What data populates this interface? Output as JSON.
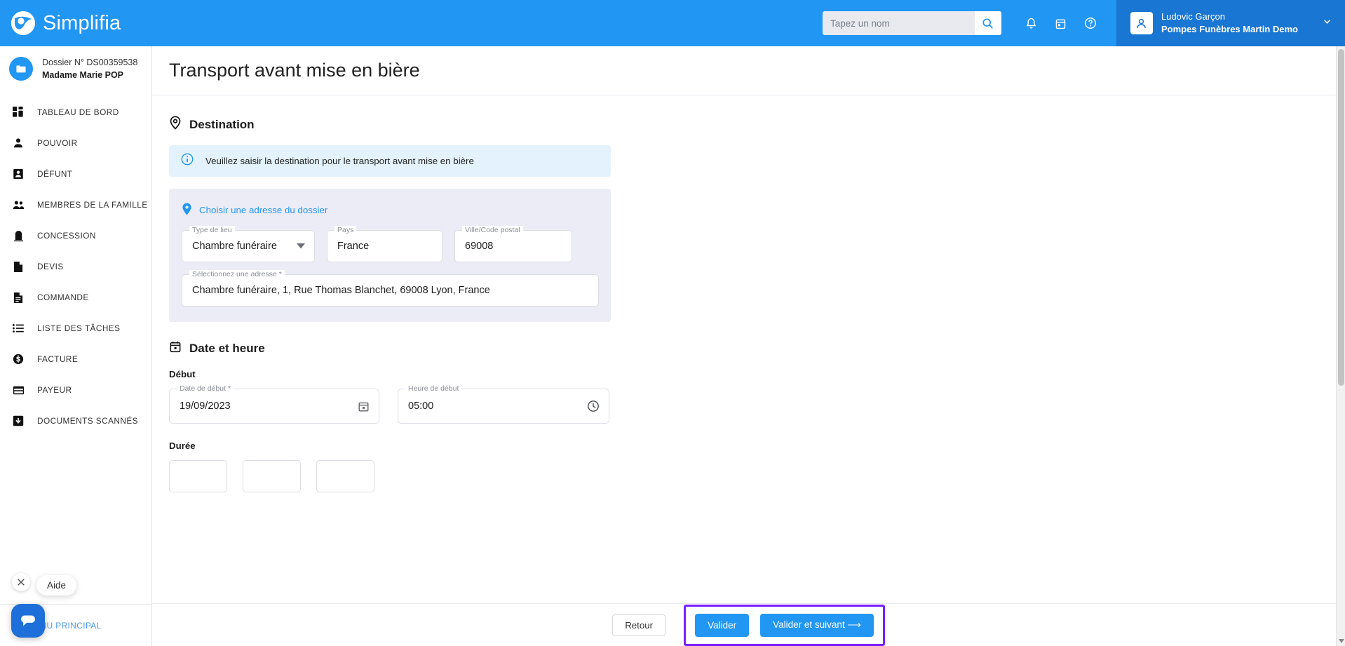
{
  "header": {
    "brand": "Simplifia",
    "search": {
      "placeholder": "Tapez un nom",
      "value": ""
    },
    "icons": {
      "search": "search-icon",
      "bell": "bell-icon",
      "calendar": "calendar-icon",
      "help": "help-circle-icon",
      "chevron": "chevron-down-icon"
    },
    "user": {
      "name": "Ludovic Garçon",
      "org": "Pompes Funèbres Martin Demo"
    },
    "brand_color": "#2196f3",
    "user_chip_color": "#1976d2"
  },
  "sidebar": {
    "dossier": {
      "number": "Dossier N° DS00359538",
      "person": "Madame Marie POP",
      "icon": "folder-icon"
    },
    "items": [
      {
        "label": "Tableau de bord",
        "icon": "dashboard-icon"
      },
      {
        "label": "Pouvoir",
        "icon": "person-icon"
      },
      {
        "label": "Défunt",
        "icon": "person-badge-icon"
      },
      {
        "label": "Membres de la famille",
        "icon": "people-icon"
      },
      {
        "label": "Concession",
        "icon": "headstone-icon"
      },
      {
        "label": "Devis",
        "icon": "document-icon"
      },
      {
        "label": "Commande",
        "icon": "document-lines-icon"
      },
      {
        "label": "Liste des tâches",
        "icon": "list-icon"
      },
      {
        "label": "Facture",
        "icon": "dollar-coin-icon"
      },
      {
        "label": "Payeur",
        "icon": "credit-card-icon"
      },
      {
        "label": "Documents scannés",
        "icon": "scan-document-icon"
      }
    ],
    "menu_principal": {
      "label": "Menu principal",
      "icon": "chevron-left-icon"
    }
  },
  "page": {
    "title": "Transport avant mise en bière"
  },
  "destination": {
    "section_title": "Destination",
    "section_icon": "map-pin-icon",
    "info_banner": {
      "text": "Veuillez saisir la destination pour le transport avant mise en bière",
      "icon": "info-circle-icon"
    },
    "choose_address_link": {
      "label": "Choisir une adresse du dossier",
      "icon": "map-pin-filled-icon"
    },
    "fields": [
      {
        "label": "Type de lieu",
        "value": "Chambre funéraire",
        "icon": "caret-down-icon"
      },
      {
        "label": "Pays",
        "value": "France",
        "icon": ""
      },
      {
        "label": "Ville/Code postal",
        "value": "69008",
        "icon": ""
      }
    ],
    "address_field": {
      "label": "Sélectionnez une adresse *",
      "value": "Chambre funéraire,  1, Rue Thomas Blanchet, 69008 Lyon, France"
    }
  },
  "datetime": {
    "section_title": "Date et heure",
    "section_icon": "calendar-icon",
    "debut_label": "Début",
    "date_field": {
      "label": "Date de début *",
      "value": "19/09/2023",
      "icon": "calendar-icon"
    },
    "time_field": {
      "label": "Heure de début",
      "value": "05:00",
      "icon": "clock-icon"
    },
    "duree_label": "Durée"
  },
  "footer": {
    "back_label": "Retour",
    "validate_label": "Valider",
    "validate_next_label": "Valider et suivant ⟶",
    "highlight_color": "#7b1fff",
    "primary_color": "#2196f3"
  },
  "chat": {
    "tooltip": "Aide",
    "close_icon": "close-icon",
    "bubble_icon": "chat-bubble-icon"
  }
}
